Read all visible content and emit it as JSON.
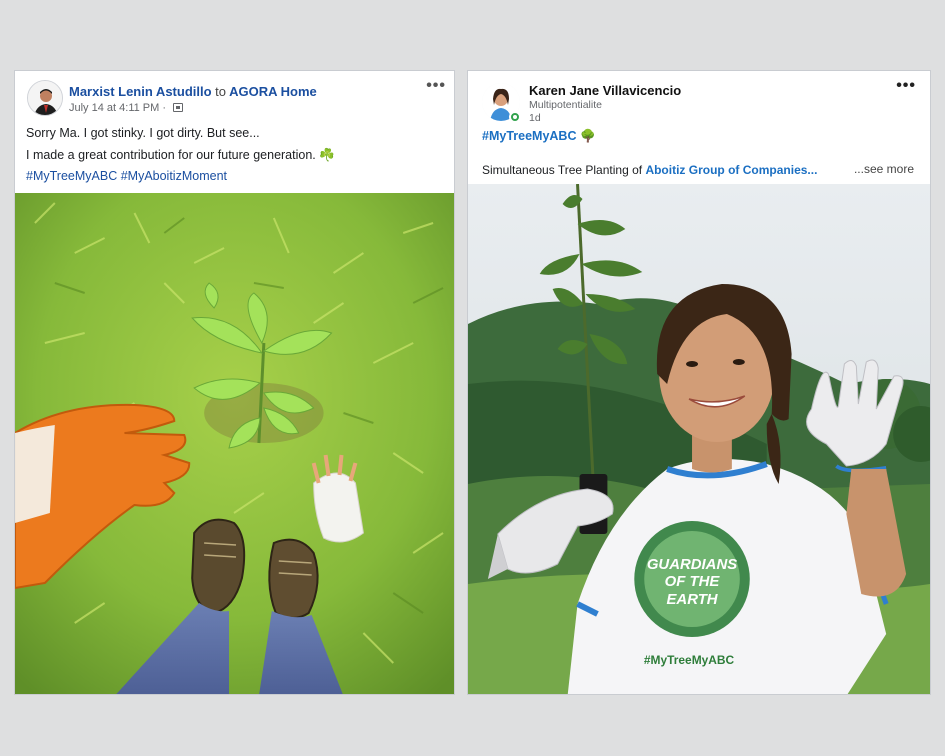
{
  "post1": {
    "author": "Marxist Lenin Astudillo",
    "to_word": "to",
    "group": "AGORA Home",
    "timestamp": "July 14 at 4:11 PM · ",
    "more_label": "•••",
    "line1": "Sorry Ma. I got stinky. I got dirty. But see...",
    "line2": "I made a great contribution for our future generation. ",
    "line2_emoji": "☘️",
    "hashtag1": "#MyTreeMyABC",
    "hashtag2": "#MyAboitizMoment"
  },
  "post2": {
    "author": "Karen Jane Villavicencio",
    "subtitle": "Multipotentialite",
    "time": "1d",
    "more_label": "•••",
    "hashtag": "#MyTreeMyABC",
    "hashtag_emoji": "🌳",
    "body_prefix": "Simultaneous Tree Planting of ",
    "body_link": "Aboitiz Group of Companies...",
    "see_more": "...see more",
    "shirt_line1": "GUARDIANS",
    "shirt_line2": "OF THE",
    "shirt_line3": "EARTH",
    "shirt_hashtag": "#MyTreeMyABC"
  },
  "colors": {
    "link_blue": "#1b4fa0",
    "hashtag_blue": "#1b6fc2",
    "grass_green": "#8cc13c",
    "glove_orange": "#ec7a1e",
    "online_green": "#31a24c"
  },
  "icons": {
    "group_icon": "group-icon",
    "online_indicator": "online-status-icon"
  }
}
